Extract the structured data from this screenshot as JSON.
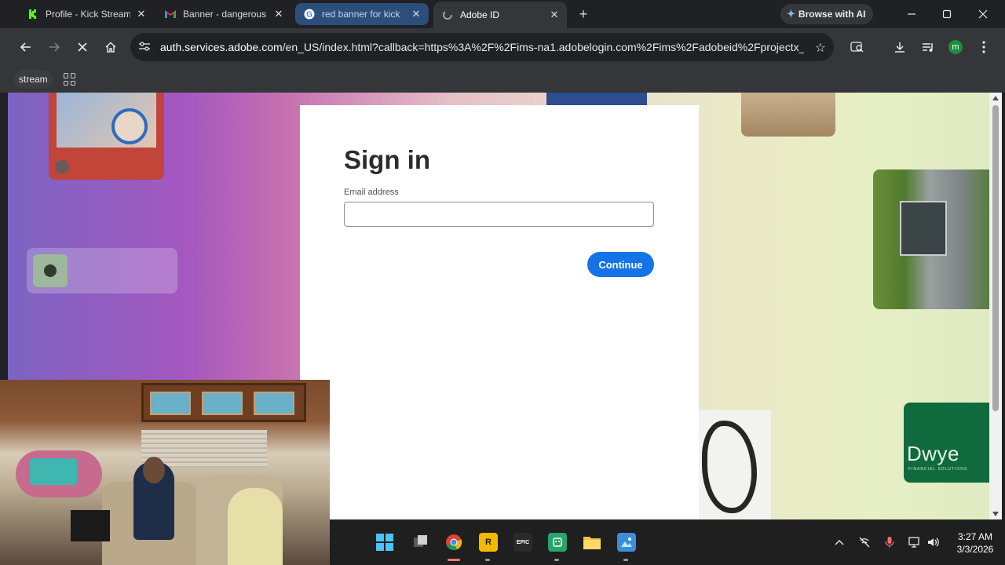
{
  "browser": {
    "tabs": [
      {
        "title": "Profile - Kick Stream",
        "favicon": "kick-icon",
        "state": "normal"
      },
      {
        "title": "Banner - dangerous",
        "favicon": "gmail-icon",
        "state": "normal"
      },
      {
        "title": "red banner for kick",
        "favicon": "google-icon",
        "state": "hover"
      },
      {
        "title": "Adobe ID",
        "favicon": "loading-icon",
        "state": "active"
      }
    ],
    "new_tab": "+",
    "browse_ai_label": "Browse with AI",
    "url_host": "auth.services.adobe.com",
    "url_rest": "/en_US/index.html?callback=https%3A%2F%2Fims-na1.adobelogin.com%2Fims%2Fadobeid%2Fprojectx_w...",
    "profile_initial": "m",
    "bookmark_label": "stream"
  },
  "signin": {
    "heading": "Sign in",
    "email_label": "Email address",
    "email_value": "",
    "continue_label": "Continue"
  },
  "page_deco": {
    "dwyer_name": "Dwye",
    "dwyer_sub": "FINANCIAL SOLUTIONS"
  },
  "taskbar": {
    "apps": [
      "start-icon",
      "task-view-icon",
      "chrome-icon",
      "rockstar-icon",
      "epic-games-icon",
      "android-app-icon",
      "file-explorer-icon",
      "photos-icon"
    ],
    "time": "3:27 AM",
    "date": "3/3/2026"
  },
  "colors": {
    "accent": "#1473e6",
    "browser_bg": "#202124",
    "toolbar_bg": "#35363a",
    "tab_hover": "#2b4f7a"
  }
}
